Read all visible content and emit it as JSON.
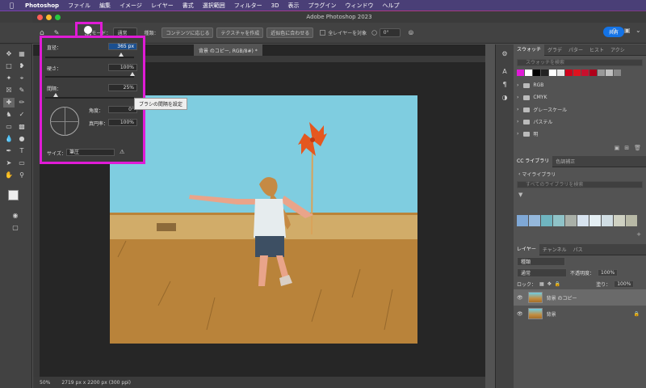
{
  "menubar": {
    "items": [
      "Photoshop",
      "ファイル",
      "編集",
      "イメージ",
      "レイヤー",
      "書式",
      "選択範囲",
      "フィルター",
      "3D",
      "表示",
      "プラグイン",
      "ウィンドウ",
      "ヘルプ"
    ]
  },
  "window": {
    "title": "Adobe Photoshop 2023"
  },
  "options": {
    "mode_label": "モード：",
    "mode_value": "通常",
    "type_label": "種類：",
    "btn_content": "コンテンツに応じる",
    "btn_texture": "テクスチャを作成",
    "btn_near": "近似色に合わせる",
    "all_layers": "全レイヤーを対象",
    "angle": "0°",
    "share": "共有",
    "brush_size": "365"
  },
  "doc": {
    "tab": "背景 のコピー, RGB/8#) *",
    "zoom": "50%",
    "dims": "2719 px x 2200 px (300 ppi)",
    "ruler": [
      "0",
      "200",
      "400",
      "600",
      "800",
      "1000",
      "1200",
      "1400",
      "1600",
      "1800",
      "2000",
      "2200",
      "2400",
      "2600",
      "2800",
      "3000",
      "3200"
    ]
  },
  "popup": {
    "size_label": "直径：",
    "size_value": "365 px",
    "hardness_label": "硬さ：",
    "hardness_value": "100%",
    "spacing_label": "間隔：",
    "spacing_value": "25%",
    "angle_label": "角度：",
    "angle_value": "0°",
    "roundness_label": "真円率：",
    "roundness_value": "100%",
    "size_mode_label": "サイズ：",
    "size_mode_value": "筆圧",
    "tooltip": "ブラシの間隔を設定",
    "size_fraction": 0.85,
    "hardness_fraction": 0.98,
    "spacing_fraction": 0.12
  },
  "swatches_panel": {
    "tabs": [
      "スウォッチ",
      "グラデ",
      "パター",
      "ヒスト",
      "アクシ"
    ],
    "search_placeholder": "スウォッチを検索",
    "colors": [
      "#e01bd6",
      "#ffffff",
      "#000000",
      "#222222",
      "#ffffff",
      "#e8e8e8",
      "#d0021b",
      "#e0121e",
      "#c8102e",
      "#b0001a",
      "#999999",
      "#c0c0c0",
      "#888888"
    ],
    "folders": [
      "RGB",
      "CMYK",
      "グレースケール",
      "パステル",
      "明"
    ]
  },
  "library_panel": {
    "tabs": [
      "CC ライブラリ",
      "色調補正"
    ],
    "library": "マイライブラリ",
    "search_placeholder": "すべてのライブラリを検索",
    "theme_colors": [
      "#7fa8d6",
      "#95b8db",
      "#6fb5c0",
      "#8fc3c8",
      "#a9b0a8",
      "#d7e3ef",
      "#e4eef3",
      "#d0dde3",
      "#cfd1c2",
      "#b8b9a6"
    ]
  },
  "layers_panel": {
    "tabs": [
      "レイヤー",
      "チャンネル",
      "パス"
    ],
    "kind": "種類",
    "blend": "通常",
    "opacity_label": "不透明度：",
    "opacity": "100%",
    "lock_label": "ロック：",
    "fill_label": "塗り：",
    "fill": "100%",
    "layers": [
      "背景 のコピー",
      "背景"
    ]
  }
}
